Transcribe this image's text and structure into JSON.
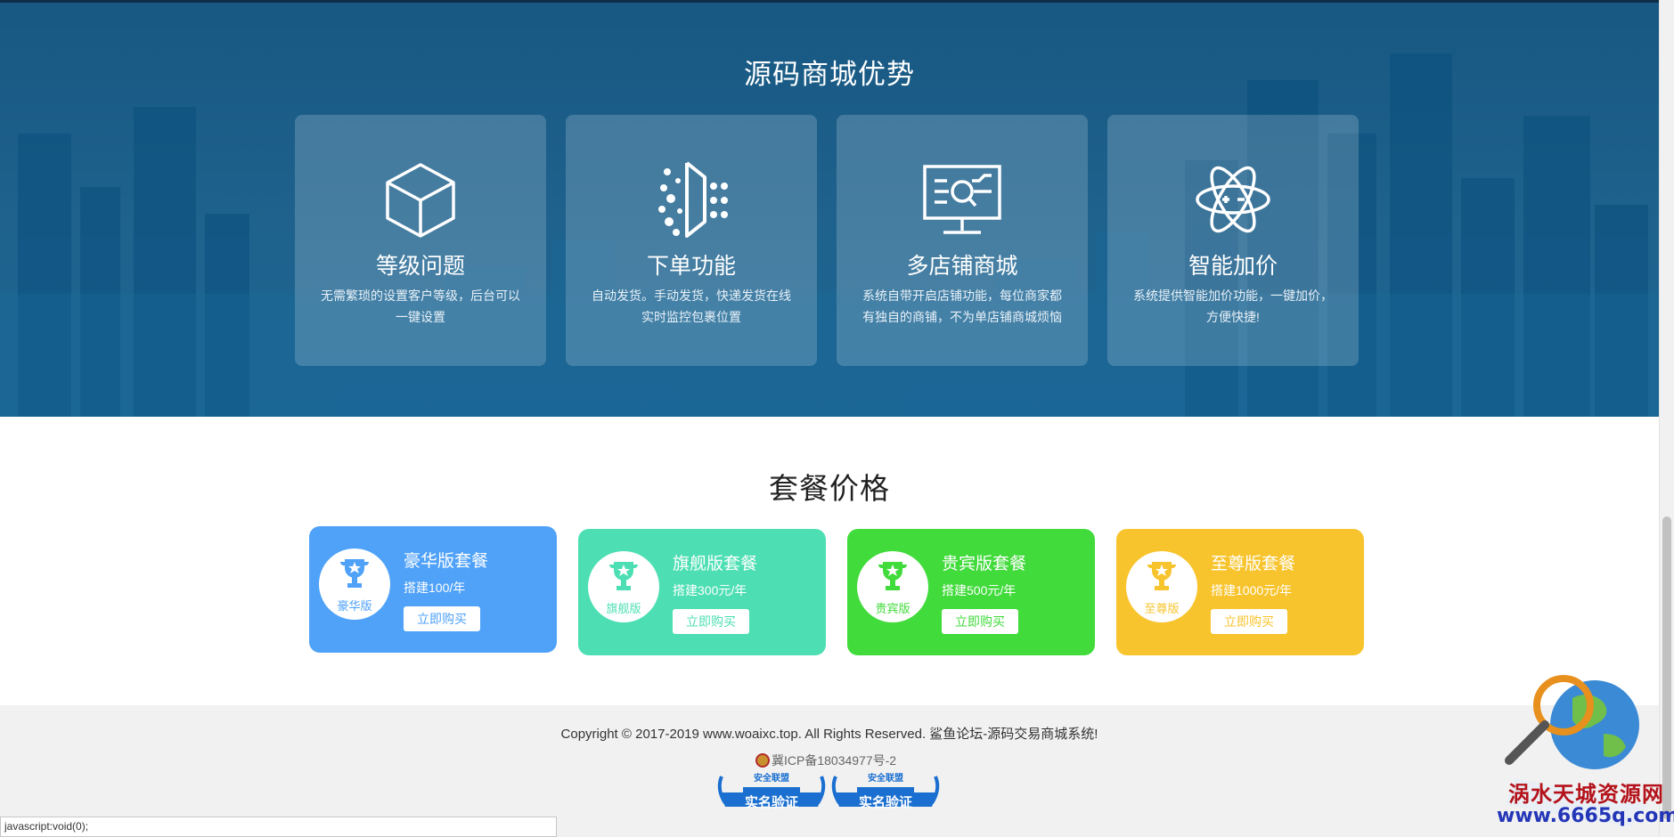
{
  "advantages": {
    "title": "源码商城优势",
    "cards": [
      {
        "icon": "cube-icon",
        "title": "等级问题",
        "desc": "无需繁琐的设置客户等级，后台可以一键设置"
      },
      {
        "icon": "order-dots-icon",
        "title": "下单功能",
        "desc": "自动发货。手动发货，快递发货在线实时监控包裹位置"
      },
      {
        "icon": "monitor-search-icon",
        "title": "多店铺商城",
        "desc": "系统自带开启店铺功能，每位商家都有独自的商铺，不为单店铺商城烦恼"
      },
      {
        "icon": "atom-icon",
        "title": "智能加价",
        "desc": "系统提供智能加价功能，一键加价，方便快捷!"
      }
    ]
  },
  "pricing": {
    "title": "套餐价格",
    "plans": [
      {
        "name": "豪华版套餐",
        "badge": "豪华版",
        "price": "搭建100/年",
        "button": "立即购买",
        "color": "#4fa2f8"
      },
      {
        "name": "旗舰版套餐",
        "badge": "旗舰版",
        "price": "搭建300元/年",
        "button": "立即购买",
        "color": "#4ddfb3"
      },
      {
        "name": "贵宾版套餐",
        "badge": "贵宾版",
        "price": "搭建500元/年",
        "button": "立即购买",
        "color": "#41db3b"
      },
      {
        "name": "至尊版套餐",
        "badge": "至尊版",
        "price": "搭建1000元/年",
        "button": "立即购买",
        "color": "#f8c42e"
      }
    ]
  },
  "footer": {
    "copyright": "Copyright © 2017-2019 www.woaixc.top. All Rights Reserved. 鲨鱼论坛-源码交易商城系统!",
    "icp": "冀ICP备18034977号-2",
    "verify_badges": [
      {
        "top": "安全联盟",
        "main": "实名验证"
      },
      {
        "top": "安全联盟",
        "main": "实名验证"
      }
    ]
  },
  "statusbar": {
    "text": "javascript:void(0);"
  },
  "watermark": {
    "name": "涡水天城资源网",
    "url": "www.6665q.com"
  }
}
